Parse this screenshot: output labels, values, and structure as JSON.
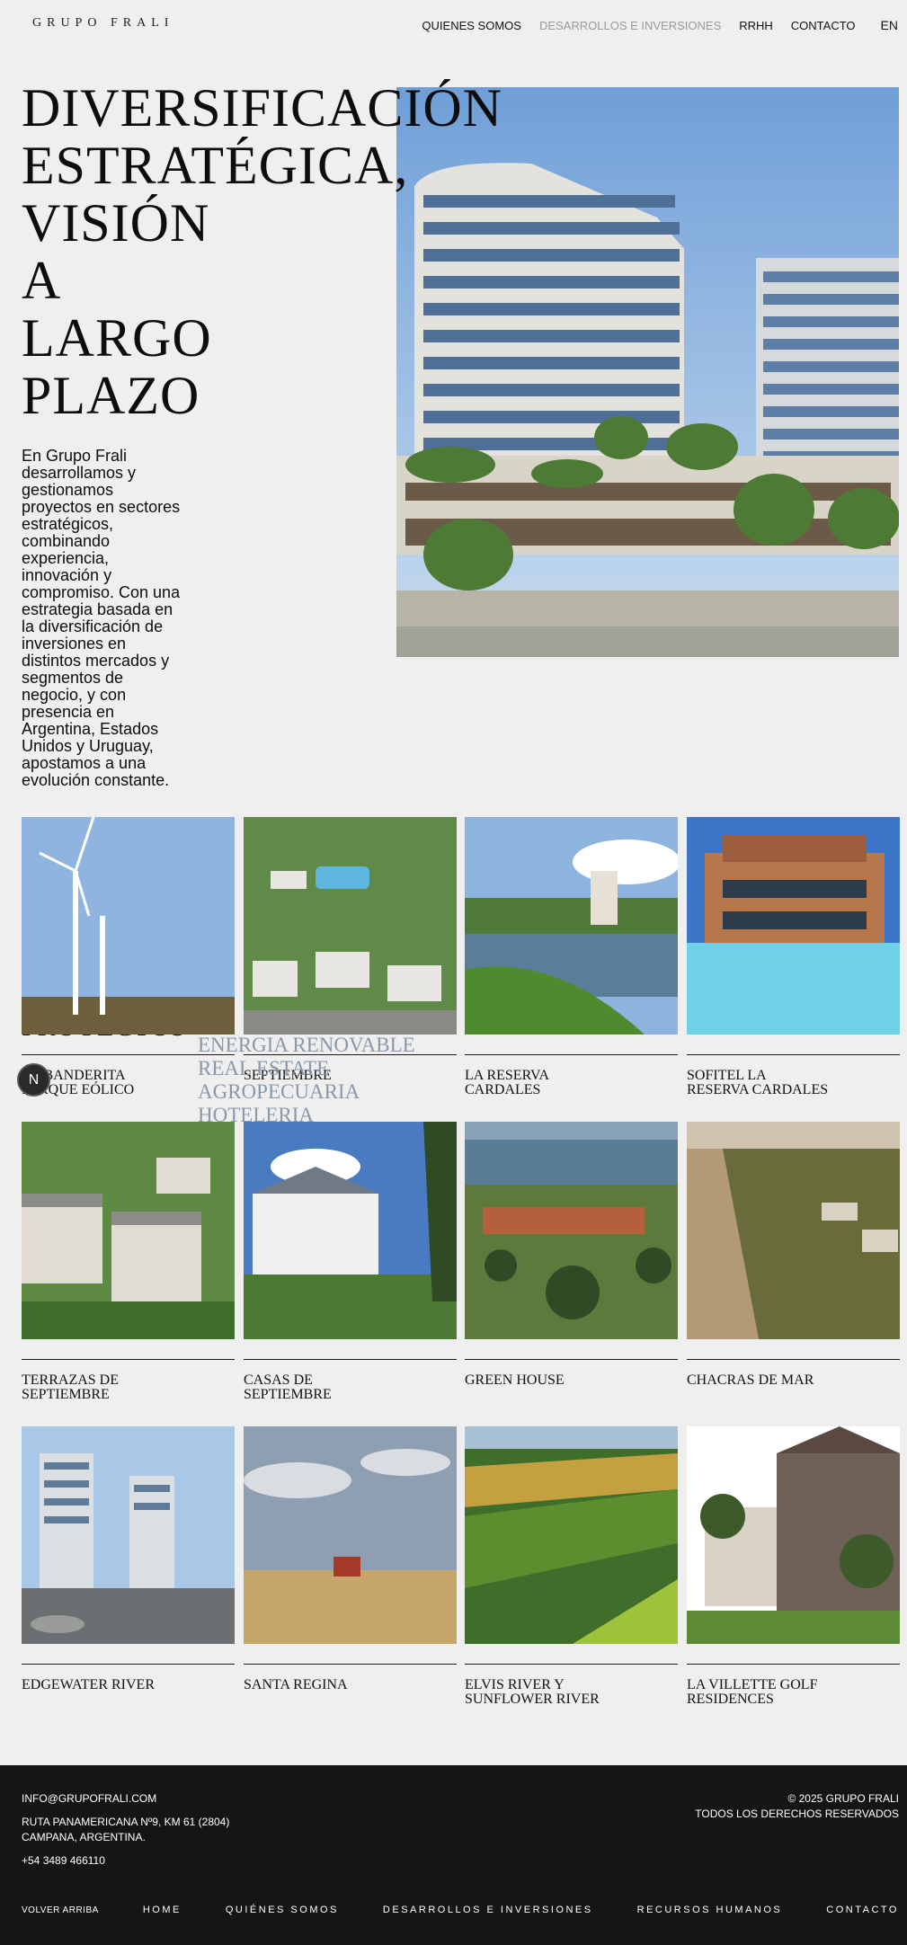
{
  "header": {
    "logo": "GRUPO FRALI",
    "nav": [
      "QUIENES SOMOS",
      "DESARROLLOS E INVERSIONES",
      "RRHH",
      "CONTACTO"
    ],
    "lang": "EN"
  },
  "hero": {
    "title": "DIVERSIFICACIÓN\nESTRATÉGICA,\nVISIÓN\nA\nLARGO\nPLAZO",
    "text": "En Grupo Frali desarrollamos y gestionamos proyectos en sectores estratégicos, combinando experiencia, innovación y compromiso. Con una estrategia basada en la diversificación de inversiones en distintos mercados y segmentos de negocio, y con presencia en Argentina, Estados Unidos y Uruguay, apostamos a una evolución constante."
  },
  "projects": {
    "heading": "PROYECTOS",
    "categories": [
      "ENERGIA RENOVABLE",
      "REAL ESTATE",
      "AGROPECUARIA",
      "HOTELERIA"
    ],
    "fab_label": "N",
    "items": [
      {
        "name": "LA BANDERITA\nPARQUE EÓLICO"
      },
      {
        "name": "SEPTIEMBRE"
      },
      {
        "name": "LA RESERVA\nCARDALES"
      },
      {
        "name": "SOFITEL LA\nRESERVA CARDALES"
      },
      {
        "name": "TERRAZAS DE\nSEPTIEMBRE"
      },
      {
        "name": "CASAS DE\nSEPTIEMBRE"
      },
      {
        "name": "GREEN HOUSE"
      },
      {
        "name": "CHACRAS DE MAR"
      },
      {
        "name": "EDGEWATER RIVER"
      },
      {
        "name": "SANTA REGINA"
      },
      {
        "name": "ELVIS RIVER Y\nSUNFLOWER RIVER"
      },
      {
        "name": "LA VILLETTE GOLF\nRESIDENCES"
      }
    ]
  },
  "footer": {
    "email": "INFO@GRUPOFRALI.COM",
    "address_1": "RUTA PANAMERICANA Nº9, KM 61 (2804)",
    "address_2": "CAMPANA, ARGENTINA.",
    "phone": "+54 3489 466110",
    "copyright": "© 2025 GRUPO FRALI",
    "rights": "TODOS LOS DERECHOS RESERVADOS",
    "back_to_top": "VOLVER ARRIBA",
    "nav": [
      "HOME",
      "QUIÉNES SOMOS",
      "DESARROLLOS E INVERSIONES",
      "RECURSOS HUMANOS",
      "CONTACTO"
    ]
  }
}
